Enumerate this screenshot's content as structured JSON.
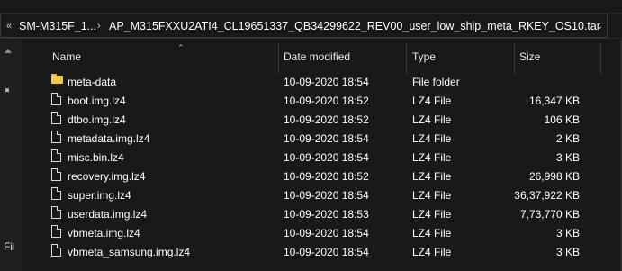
{
  "address": {
    "segments": [
      "SM-M315F_1...",
      "AP_M315FXXU2ATI4_CL19651337_QB34299622_REV00_user_low_ship_meta_RKEY_OS10.tar"
    ],
    "overflow": "«",
    "separator": "›"
  },
  "nav": {
    "pinned_label": "Fil"
  },
  "columns": [
    "Name",
    "Date modified",
    "Type",
    "Size"
  ],
  "files": [
    {
      "name": "meta-data",
      "date": "10-09-2020 18:54",
      "type": "File folder",
      "size": "",
      "icon": "folder-icon"
    },
    {
      "name": "boot.img.lz4",
      "date": "10-09-2020 18:52",
      "type": "LZ4 File",
      "size": "16,347 KB",
      "icon": "file-icon"
    },
    {
      "name": "dtbo.img.lz4",
      "date": "10-09-2020 18:52",
      "type": "LZ4 File",
      "size": "106 KB",
      "icon": "file-icon"
    },
    {
      "name": "metadata.img.lz4",
      "date": "10-09-2020 18:54",
      "type": "LZ4 File",
      "size": "2 KB",
      "icon": "file-icon"
    },
    {
      "name": "misc.bin.lz4",
      "date": "10-09-2020 18:54",
      "type": "LZ4 File",
      "size": "3 KB",
      "icon": "file-icon"
    },
    {
      "name": "recovery.img.lz4",
      "date": "10-09-2020 18:52",
      "type": "LZ4 File",
      "size": "26,998 KB",
      "icon": "file-icon"
    },
    {
      "name": "super.img.lz4",
      "date": "10-09-2020 18:54",
      "type": "LZ4 File",
      "size": "36,37,922 KB",
      "icon": "file-icon"
    },
    {
      "name": "userdata.img.lz4",
      "date": "10-09-2020 18:53",
      "type": "LZ4 File",
      "size": "7,73,770 KB",
      "icon": "file-icon"
    },
    {
      "name": "vbmeta.img.lz4",
      "date": "10-09-2020 18:54",
      "type": "LZ4 File",
      "size": "3 KB",
      "icon": "file-icon"
    },
    {
      "name": "vbmeta_samsung.img.lz4",
      "date": "10-09-2020 18:54",
      "type": "LZ4 File",
      "size": "3 KB",
      "icon": "file-icon"
    }
  ],
  "colors": {
    "background": "#191919",
    "text": "#ffffff",
    "folder": "#f3c84a"
  }
}
